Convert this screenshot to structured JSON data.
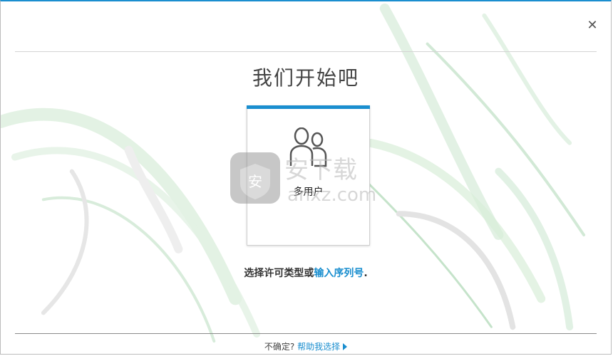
{
  "window": {
    "accent_color": "#1a8ecf",
    "close_icon": "close-icon"
  },
  "title": "我们开始吧",
  "license_card": {
    "label": "多用户",
    "icon": "multi-user-icon"
  },
  "prompt": {
    "text_before": "选择许可类型或",
    "link": "输入序列号",
    "text_after": "."
  },
  "footer": {
    "question": "不确定?",
    "link": "帮助我选择",
    "icon": "triangle-right-icon"
  },
  "watermark": {
    "text": "安下载",
    "domain": "anxz.com",
    "badge": "安"
  }
}
